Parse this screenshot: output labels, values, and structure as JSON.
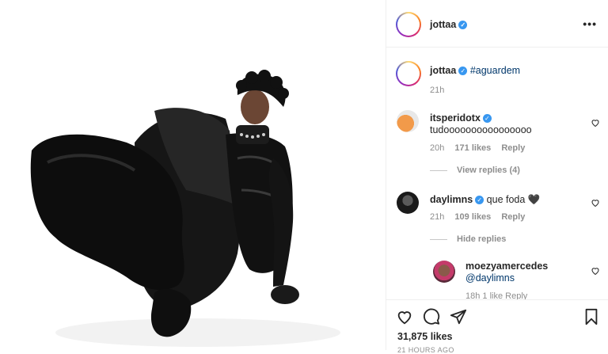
{
  "header": {
    "username": "jottaa"
  },
  "caption": {
    "username": "jottaa",
    "text": "#aguardem",
    "time": "21h"
  },
  "comments": [
    {
      "username": "itsperidotx",
      "text": "tudoooooooooooooooo",
      "time": "20h",
      "likes": "171 likes",
      "reply": "Reply",
      "view_replies": "View replies (4)"
    },
    {
      "username": "daylimns",
      "text": "que foda 🖤",
      "time": "21h",
      "likes": "109 likes",
      "reply": "Reply",
      "hide_replies": "Hide replies"
    }
  ],
  "nested_reply": {
    "username": "moezyamercedes",
    "mention": "@daylimns",
    "partial_meta": "18h  1 like  Reply"
  },
  "actions": {
    "likes": "31,875 likes",
    "timestamp": "21 HOURS AGO"
  },
  "colors": {
    "verified": "#3897f0",
    "link": "#00376b",
    "muted": "#8e8e8e"
  }
}
